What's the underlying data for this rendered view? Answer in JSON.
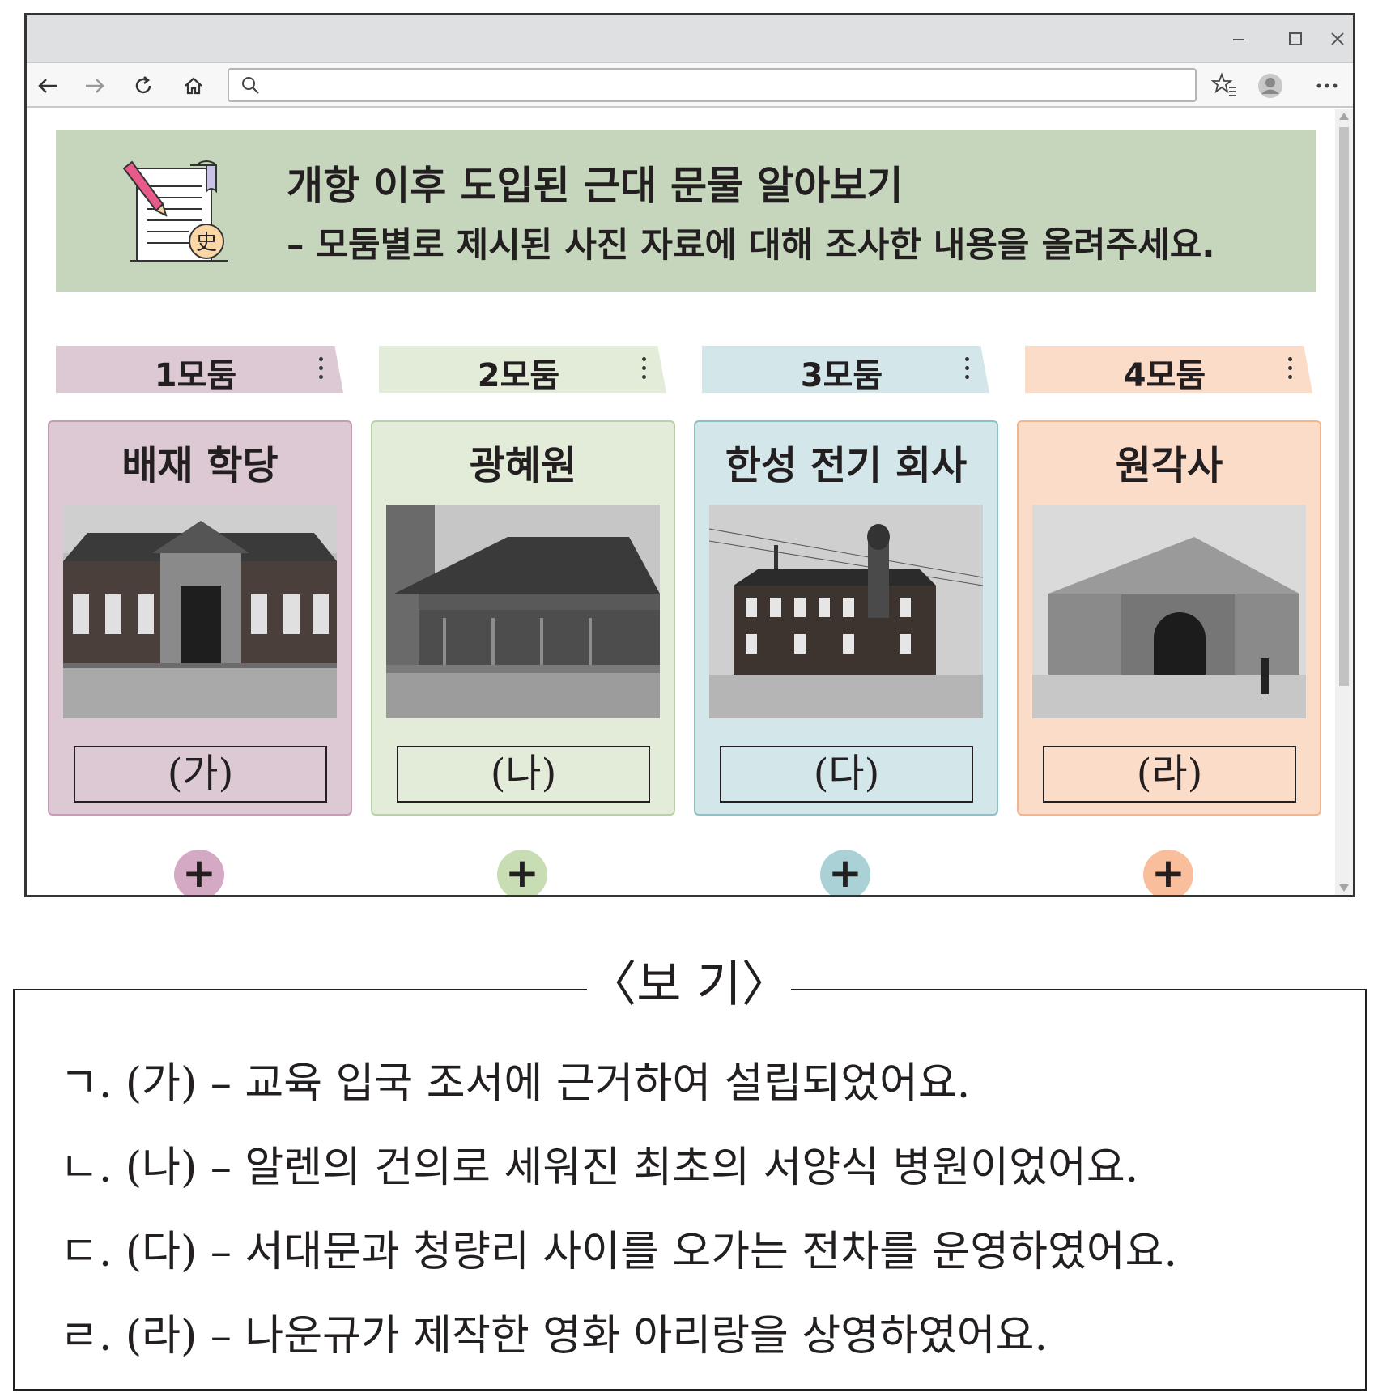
{
  "browser": {
    "address_value": "",
    "address_placeholder": "",
    "icons": [
      "back-icon",
      "forward-icon",
      "refresh-icon",
      "home-icon",
      "search-icon",
      "favorites-icon",
      "profile-icon",
      "more-icon",
      "minimize-icon",
      "maximize-icon",
      "close-icon"
    ]
  },
  "banner": {
    "title": "개항 이후 도입된 근대 문물 알아보기",
    "subtitle": "– 모둠별로 제시된 사진 자료에 대해 조사한 내용을 올려주세요.",
    "badge": "史"
  },
  "groups": [
    {
      "tab": "1모둠",
      "title": "배재 학당",
      "label": "(가)",
      "color": "#dcc9d4",
      "border": "#c79ab6",
      "plus_color": "#d4a9c3"
    },
    {
      "tab": "2모둠",
      "title": "광혜원",
      "label": "(나)",
      "color": "#e3ecd9",
      "border": "#b9d1a8",
      "plus_color": "#c9ddb5"
    },
    {
      "tab": "3모둠",
      "title": "한성 전기 회사",
      "label": "(다)",
      "color": "#d3e6e9",
      "border": "#8fc0c6",
      "plus_color": "#a9d1d6"
    },
    {
      "tab": "4모둠",
      "title": "원각사",
      "label": "(라)",
      "color": "#fbdcc8",
      "border": "#f2b58e",
      "plus_color": "#f9bf9c"
    }
  ],
  "example": {
    "title": "〈보 기〉",
    "items": [
      "ㄱ. (가) – 교육 입국 조서에 근거하여 설립되었어요.",
      "ㄴ. (나) – 알렌의 건의로 세워진 최초의 서양식 병원이었어요.",
      "ㄷ. (다) – 서대문과 청량리 사이를 오가는 전차를 운영하였어요.",
      "ㄹ. (라) – 나운규가 제작한 영화 아리랑을 상영하였어요."
    ]
  }
}
